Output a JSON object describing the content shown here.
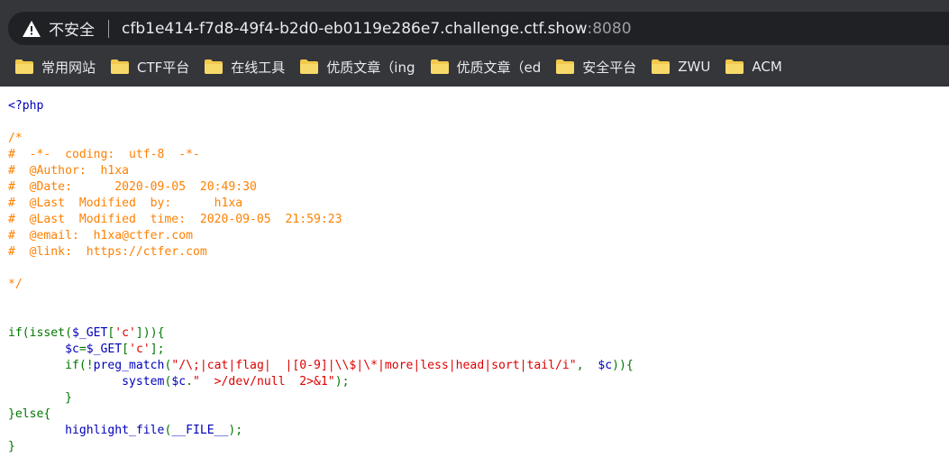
{
  "browser": {
    "insecure_label": "不安全",
    "url_host": "cfb1e414-f7d8-49f4-b2d0-eb0119e286e7.challenge.ctf.show",
    "url_port": ":8080"
  },
  "bookmarks": [
    {
      "label": "常用网站"
    },
    {
      "label": "CTF平台"
    },
    {
      "label": "在线工具"
    },
    {
      "label": "优质文章（ing"
    },
    {
      "label": "优质文章（ed"
    },
    {
      "label": "安全平台"
    },
    {
      "label": "ZWU"
    },
    {
      "label": "ACM"
    }
  ],
  "colors": {
    "default": "#0000bb",
    "comment": "#ff8000",
    "keyword": "#007700",
    "string": "#dd0000"
  },
  "code": {
    "open_tag": "<?php",
    "comment_block": [
      "/*",
      "#  -*-  coding:  utf-8  -*-",
      "#  @Author:  h1xa",
      "#  @Date:      2020-09-05  20:49:30",
      "#  @Last  Modified  by:      h1xa",
      "#  @Last  Modified  time:  2020-09-05  21:59:23",
      "#  @email:  h1xa@ctfer.com",
      "#  @link:  https://ctfer.com",
      "",
      "*/"
    ],
    "l1": [
      "if(isset(",
      "$_GET",
      "[",
      "'c'",
      "])){"
    ],
    "l2": [
      "        ",
      "$c",
      "=",
      "$_GET",
      "[",
      "'c'",
      "];"
    ],
    "l3": [
      "        if(!",
      "preg_match",
      "(",
      "\"/\\;|cat|flag|  |[0-9]|\\\\$|\\*|more|less|head|sort|tail/i\"",
      ",  ",
      "$c",
      ")){"
    ],
    "l4": [
      "                ",
      "system",
      "(",
      "$c",
      ".",
      "\"  >/dev/null  2>&1\"",
      ");"
    ],
    "l5": [
      "        }"
    ],
    "l6": [
      "}else{"
    ],
    "l7": [
      "        ",
      "highlight_file",
      "(",
      "__FILE__",
      ");"
    ],
    "l8": [
      "}"
    ]
  }
}
